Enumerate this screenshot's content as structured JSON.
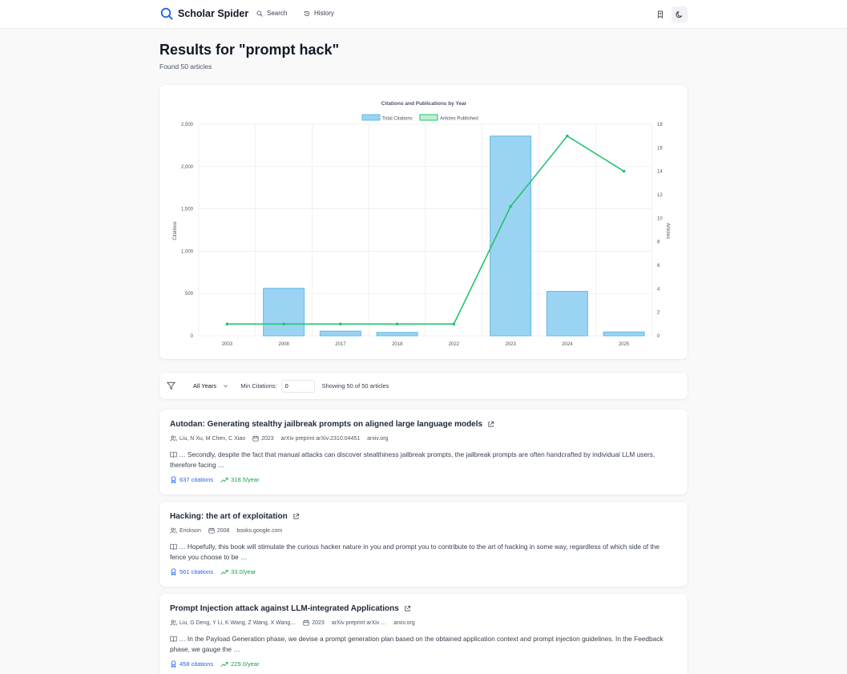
{
  "app": {
    "name": "Scholar Spider"
  },
  "nav": {
    "search_label": "Search",
    "history_label": "History"
  },
  "header": {
    "title": "Results for \"prompt hack\"",
    "subtitle": "Found 50 articles"
  },
  "chart_data": {
    "type": "bar",
    "title": "Citations and Publications by Year",
    "categories": [
      "2003",
      "2008",
      "2017",
      "2018",
      "2022",
      "2023",
      "2024",
      "2025"
    ],
    "series": [
      {
        "name": "Total Citations",
        "type": "bar",
        "axis": "left",
        "values": [
          0,
          561,
          55,
          40,
          0,
          2360,
          525,
          45
        ]
      },
      {
        "name": "Articles Published",
        "type": "line",
        "axis": "right",
        "values": [
          1,
          1,
          1,
          1,
          1,
          11,
          17,
          14
        ]
      }
    ],
    "ylabel": "Citations",
    "y2label": "Articles",
    "ylim": [
      0,
      2500
    ],
    "y2lim": [
      0,
      18
    ],
    "yticks": [
      0,
      500,
      1000,
      1500,
      2000,
      2500
    ],
    "y2ticks": [
      0,
      2,
      4,
      6,
      8,
      10,
      12,
      14,
      16,
      18
    ],
    "grid": true,
    "legend": "top-center",
    "colors": {
      "bar_fill": "#9bd3f2",
      "bar_stroke": "#60b9e8",
      "line": "#22c56e"
    }
  },
  "filters": {
    "year_select": "All Years",
    "min_citations_label": "Min Citations:",
    "min_citations_value": "0",
    "showing_text": "Showing 50 of 50 articles"
  },
  "articles": [
    {
      "title": "Autodan: Generating stealthy jailbreak prompts on aligned large language models",
      "authors": "Liu, N Xu, M Chen, C Xiao",
      "year": "2023",
      "venue": "arXiv preprint arXiv:2310.04451",
      "domain": "arxiv.org",
      "snippet": "… Secondly, despite the fact that manual attacks can discover stealthiness jailbreak prompts, the jailbreak prompts are often handcrafted by individual LLM users, therefore facing …",
      "citations": "637 citations",
      "rate": "318.5/year"
    },
    {
      "title": "Hacking: the art of exploitation",
      "authors": "Erickson",
      "year": "2008",
      "venue": "",
      "domain": "books.google.com",
      "snippet": "… Hopefully, this book will stimulate the curious hacker nature in you and prompt you to contribute to the art of hacking in some way, regardless of which side of the fence you choose to be …",
      "citations": "561 citations",
      "rate": "33.0/year"
    },
    {
      "title": "Prompt Injection attack against LLM-integrated Applications",
      "authors": "Liu, G Deng, Y Li, K Wang, Z Wang, X Wang…",
      "year": "2023",
      "venue": "arXiv preprint arXiv …",
      "domain": "arxiv.org",
      "snippet": "… In the Payload Generation phase, we devise a prompt generation plan based on the obtained application context and prompt injection guidelines. In the Feedback phase, we gauge the …",
      "citations": "458 citations",
      "rate": "229.0/year"
    }
  ]
}
